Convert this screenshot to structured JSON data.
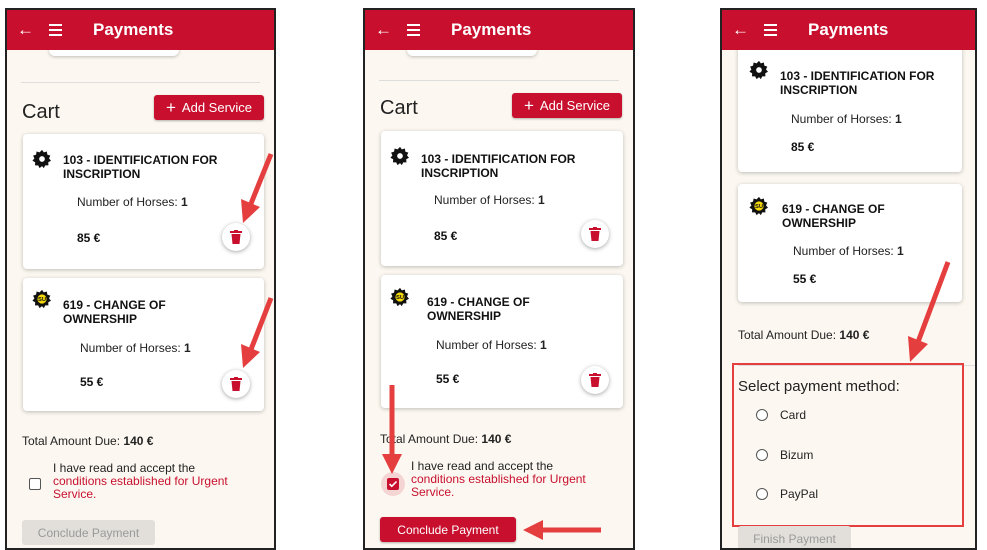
{
  "app": {
    "title": "Payments",
    "back_icon": "arrow-left-icon",
    "menu_icon": "hamburger-menu-icon",
    "brand_color": "#c8102e"
  },
  "cart": {
    "title": "Cart",
    "add_service_label": "Add Service"
  },
  "services": [
    {
      "code_title": "103 - IDENTIFICATION FOR INSCRIPTION",
      "title_line1": "103 - IDENTIFICATION FOR",
      "title_line2": "INSCRIPTION",
      "horses_label": "Number of Horses:",
      "horses": "1",
      "price": "85 €",
      "icon": "gear-icon"
    },
    {
      "code_title": "619 - CHANGE OF OWNERSHIP",
      "title_line1": "619 - CHANGE OF",
      "title_line2": "OWNERSHIP",
      "horses_label": "Number of Horses:",
      "horses": "1",
      "price": "55 €",
      "icon": "gear-su-icon",
      "badge": "SU"
    }
  ],
  "total": {
    "label": "Total Amount Due:",
    "value": "140 €"
  },
  "terms": {
    "text": "I have read and accept the",
    "link": "conditions established for Urgent Service."
  },
  "buttons": {
    "conclude": "Conclude Payment",
    "finish": "Finish Payment"
  },
  "payment": {
    "title": "Select payment method:",
    "options": [
      "Card",
      "Bizum",
      "PayPal"
    ]
  },
  "screens": [
    {
      "name": "cart-no-acceptance",
      "checkbox_checked": false,
      "conclude_enabled": false
    },
    {
      "name": "cart-accepted",
      "checkbox_checked": true,
      "conclude_enabled": true
    },
    {
      "name": "payment-method",
      "finish_enabled": false
    }
  ],
  "colors": {
    "arrow": "#e53e3e",
    "highlight": "#e53e3e",
    "background": "#fcf8f1"
  }
}
